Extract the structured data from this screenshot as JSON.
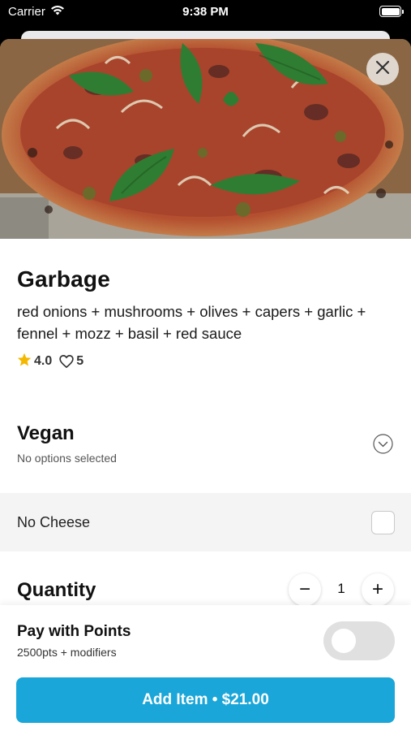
{
  "status_bar": {
    "carrier": "Carrier",
    "time": "9:38 PM",
    "icons": [
      "wifi-icon",
      "battery-icon"
    ]
  },
  "item": {
    "name": "Garbage",
    "description": "red onions + mushrooms + olives + capers + garlic + fennel +  mozz + basil + red sauce",
    "rating": "4.0",
    "likes": "5"
  },
  "modifier_group": {
    "title": "Vegan",
    "subtitle": "No options selected",
    "options": [
      {
        "label": "No Cheese",
        "checked": false
      }
    ]
  },
  "quantity": {
    "label": "Quantity",
    "value": "1",
    "decrement_symbol": "−",
    "increment_symbol": "+"
  },
  "payment": {
    "points_title": "Pay with Points",
    "points_subtitle": "2500pts + modifiers",
    "points_enabled": false
  },
  "actions": {
    "add_label": "Add Item • $21.00"
  },
  "colors": {
    "accent": "#1aa6d8",
    "star": "#f5b800",
    "option_row_bg": "#f4f4f4"
  }
}
